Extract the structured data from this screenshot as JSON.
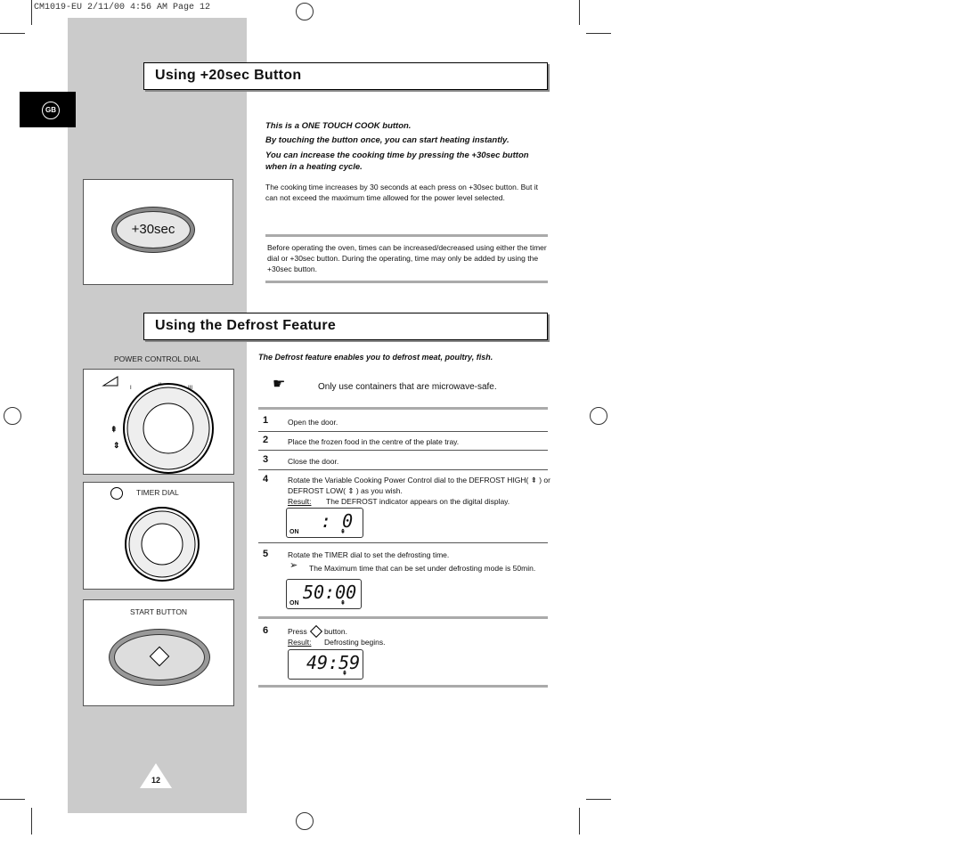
{
  "slug": "CM1019-EU  2/11/00  4:56 AM  Page 12",
  "lang_tab": "GB",
  "section1": {
    "title": "Using +20sec Button",
    "button_label": "+30sec",
    "intro": [
      "This is a ONE TOUCH COOK button.",
      "By touching the button once, you can start heating instantly.",
      "You can increase the cooking time by pressing the +30sec button when in a heating cycle."
    ],
    "body": "The cooking time increases by 30 seconds at each press on +30sec button. But it can not exceed the maximum time allowed for the power level selected.",
    "note": "Before operating the oven, times can be increased/decreased using either the timer dial or +30sec button. During the operating, time may only be added by using the +30sec button."
  },
  "section2": {
    "title": "Using the Defrost Feature",
    "power_dial_label": "POWER CONTROL DIAL",
    "timer_dial_label": "TIMER DIAL",
    "start_button_label": "START BUTTON",
    "intro": "The Defrost feature enables you to defrost meat, poultry, fish.",
    "tip": "Only use containers that are microwave-safe.",
    "steps": [
      {
        "n": "1",
        "text": "Open the door."
      },
      {
        "n": "2",
        "text": "Place the frozen food in the centre of the plate tray."
      },
      {
        "n": "3",
        "text": "Close the door."
      },
      {
        "n": "4",
        "text": "Rotate the Variable Cooking Power Control dial to the DEFROST HIGH( ⇞ ) or DEFROST LOW( ⇕ ) as you wish.",
        "result_label": "Result:",
        "result": "The DEFROST indicator appears on the digital display.",
        "display": ": 0",
        "display_on": "ON"
      },
      {
        "n": "5",
        "text": "Rotate the TIMER dial to set the defrosting time.",
        "note": "The Maximum time that can be set under defrosting mode is 50min.",
        "display": "50:00",
        "display_on": "ON"
      },
      {
        "n": "6",
        "text_pre": "Press",
        "text_post": "button.",
        "result_label": "Result:",
        "result": "Defrosting begins.",
        "display": "49:59"
      }
    ]
  },
  "page_number": "12"
}
